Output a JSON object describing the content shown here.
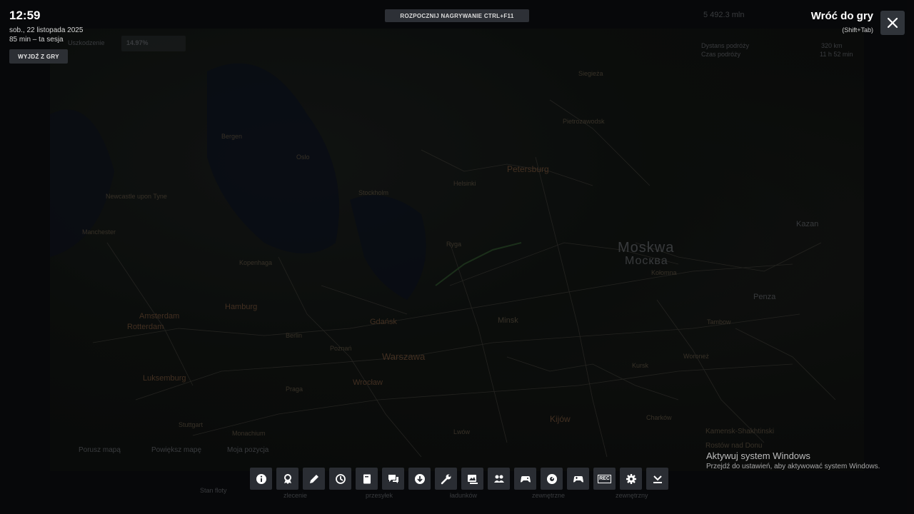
{
  "clock": "12:59",
  "date": "sob., 22 listopada 2025",
  "session": "85 min – ta sesja",
  "exit_button": "WYJDŹ Z GRY",
  "record_button": "ROZPOCZNIJ NAGRYWANIE CTRL+F11",
  "back_title": "Wróć do gry",
  "back_hint": "(Shift+Tab)",
  "activation": {
    "title": "Aktywuj system Windows",
    "subtitle": "Przejdź do ustawień, aby aktywować system Windows."
  },
  "background_hud": {
    "progress_label": "Uszkodzenie",
    "progress_value": "14.97%",
    "distance": "5 492.3 mln",
    "remaining_distance_label": "Dystans podróży",
    "remaining_distance_value": "320 km",
    "travel_time_label": "Czas podróży",
    "travel_time_value": "11 h 52 min",
    "map_hint_move": "Porusz mapą",
    "map_hint_zoom": "Powiększ mapę",
    "map_hint_position": "Moja pozycja",
    "tab_labels": [
      "Stan floty",
      "zlecenie",
      "przesyłek",
      "ładunków",
      "zewnętrzne",
      "zewnętrzny"
    ]
  },
  "map_labels": {
    "moskwa": "Moskwa",
    "moskwa_cyr": "Москва",
    "warszawa": "Warszawa",
    "gdansk": "Gdańsk",
    "ryga": "Ryga",
    "minsk": "Minsk",
    "kopenhaga": "Kopenhaga",
    "hamburg": "Hamburg",
    "amsterdam": "Amsterdam",
    "rotterdam": "Rotterdam",
    "stockholm": "Stockholm",
    "oslo": "Oslo",
    "bergen": "Bergen",
    "helsinki": "Helsinki",
    "petersburg": "Petersburg",
    "kazan": "Kazan",
    "penza": "Penza",
    "tambow": "Tambow",
    "kursk": "Kursk",
    "kijow": "Kijów",
    "lwow": "Lwów",
    "poznan": "Poznań",
    "wroclaw": "Wrocław",
    "berlin": "Berlin",
    "praga": "Praga",
    "manchester": "Manchester",
    "newcastle": "Newcastle upon Tyne",
    "luksemburg": "Luksemburg",
    "stuttgart": "Stuttgart",
    "monachium": "Monachium",
    "kamensk": "Kamensk-Shakhtinski",
    "rostow": "Rostów nad Donu",
    "woronez": "Woroneż",
    "charkow": "Charków",
    "siegieza": "Siegieża",
    "pietrozawodsk": "Pietrozawodsk",
    "kolomna": "Kołomna"
  },
  "toolbar": [
    {
      "name": "info-button",
      "icon": "info-icon"
    },
    {
      "name": "achievements-button",
      "icon": "achievement-icon"
    },
    {
      "name": "edit-button",
      "icon": "pencil-icon"
    },
    {
      "name": "recent-button",
      "icon": "history-icon"
    },
    {
      "name": "guides-button",
      "icon": "book-icon"
    },
    {
      "name": "chat-button",
      "icon": "chat-icon"
    },
    {
      "name": "downloads-button",
      "icon": "download-icon"
    },
    {
      "name": "workshop-button",
      "icon": "wrench-icon"
    },
    {
      "name": "screenshots-button",
      "icon": "screenshot-icon"
    },
    {
      "name": "friends-button",
      "icon": "friends-icon"
    },
    {
      "name": "remote-play-button",
      "icon": "remote-controller-icon"
    },
    {
      "name": "performance-button",
      "icon": "gauge-icon"
    },
    {
      "name": "controller-button",
      "icon": "controller-icon"
    },
    {
      "name": "record-button",
      "icon": "rec-icon",
      "label": "REC"
    },
    {
      "name": "settings-button",
      "icon": "gear-icon"
    },
    {
      "name": "minimize-button",
      "icon": "minimize-icon"
    }
  ]
}
